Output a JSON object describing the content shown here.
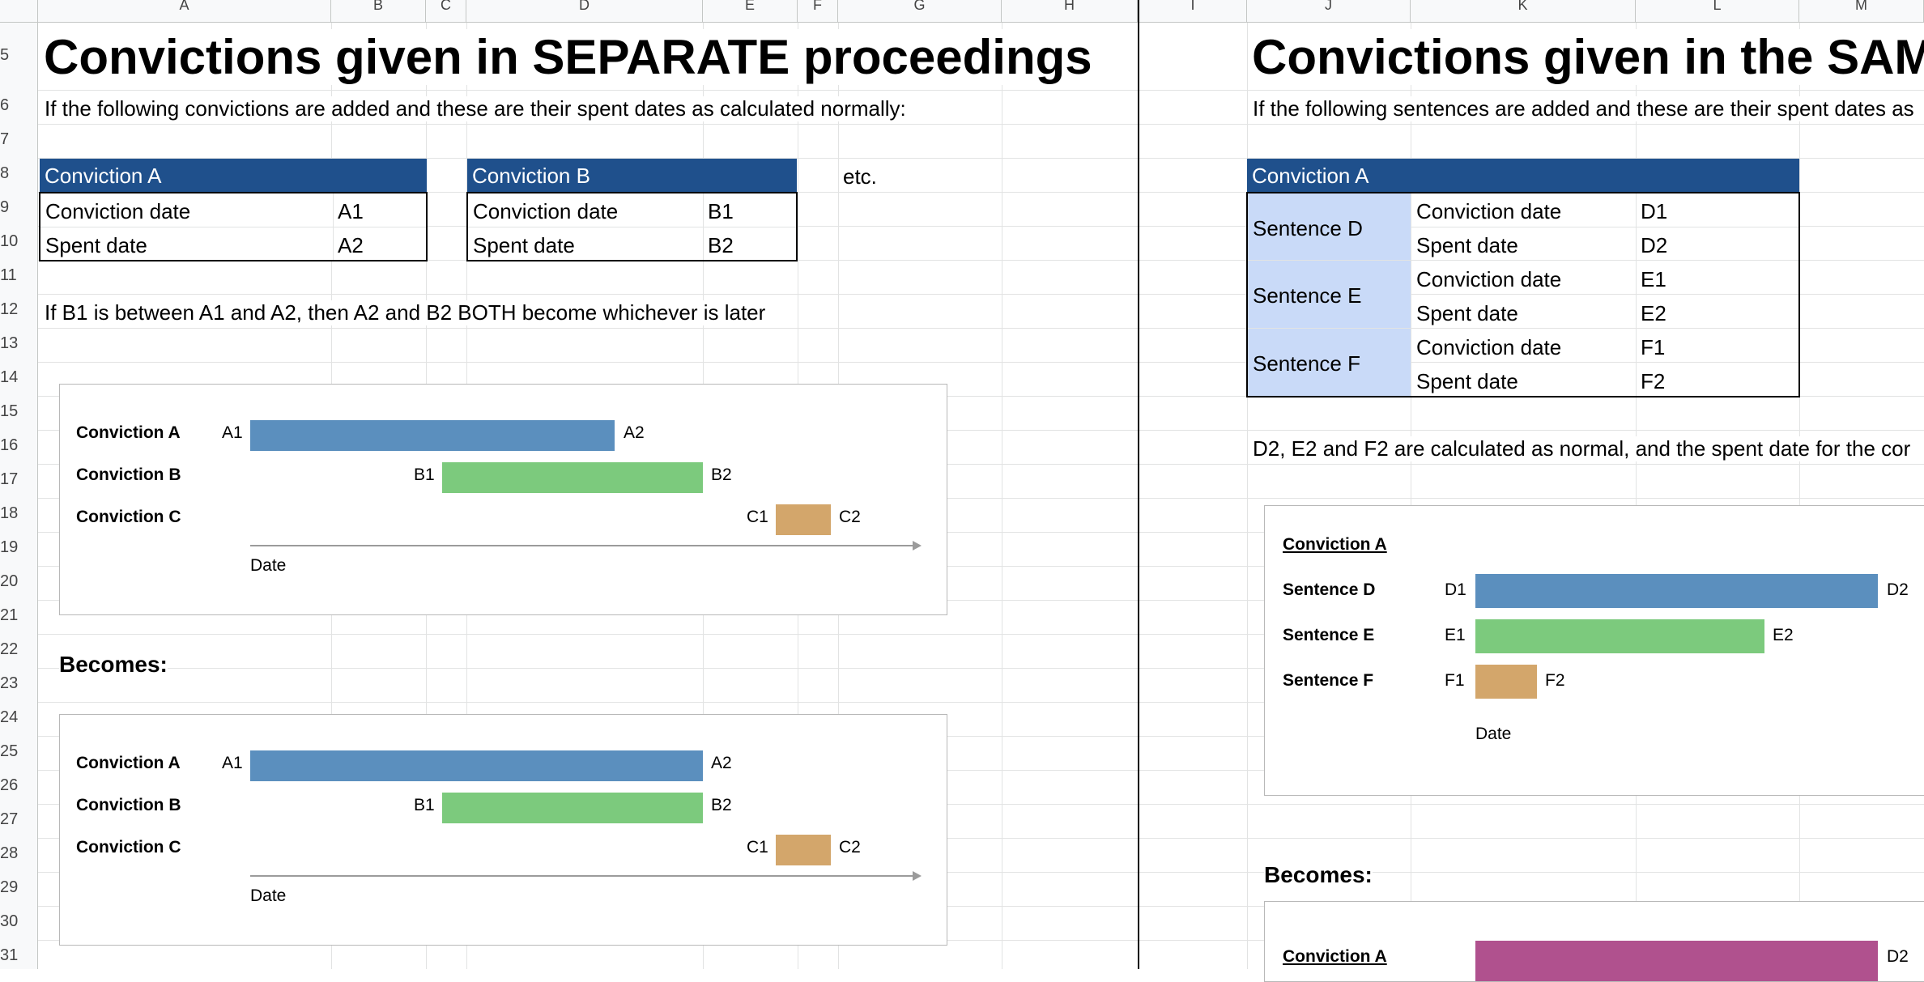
{
  "sheet": {
    "columns": [
      "A",
      "B",
      "C",
      "D",
      "E",
      "F",
      "G",
      "H",
      "I",
      "J",
      "K",
      "L",
      "M"
    ],
    "rows": [
      "5",
      "6",
      "7",
      "8",
      "9",
      "10",
      "11",
      "12",
      "13",
      "14",
      "15",
      "16",
      "17",
      "18",
      "19",
      "20",
      "21",
      "22",
      "23",
      "24",
      "25",
      "26",
      "27",
      "28",
      "29",
      "30",
      "31"
    ]
  },
  "left": {
    "title": "Convictions given in SEPARATE proceedings",
    "intro": "If the following convictions are added and these are their spent dates as calculated normally:",
    "table_a": {
      "header": "Conviction A",
      "rows": [
        [
          "Conviction date",
          "A1"
        ],
        [
          "Spent date",
          "A2"
        ]
      ]
    },
    "table_b": {
      "header": "Conviction B",
      "rows": [
        [
          "Conviction date",
          "B1"
        ],
        [
          "Spent date",
          "B2"
        ]
      ]
    },
    "etc": "etc.",
    "rule": "If B1 is between A1 and A2, then A2 and B2 BOTH become whichever is later",
    "becomes": "Becomes:",
    "chart_before": {
      "axis_label": "Date",
      "rows": [
        {
          "label": "Conviction A",
          "start": "A1",
          "end": "A2",
          "color": "#5b8fbe"
        },
        {
          "label": "Conviction B",
          "start": "B1",
          "end": "B2",
          "color": "#7cca7d"
        },
        {
          "label": "Conviction C",
          "start": "C1",
          "end": "C2",
          "color": "#d3a66b"
        }
      ]
    },
    "chart_after": {
      "axis_label": "Date",
      "rows": [
        {
          "label": "Conviction A",
          "start": "A1",
          "end": "A2",
          "color": "#5b8fbe"
        },
        {
          "label": "Conviction B",
          "start": "B1",
          "end": "B2",
          "color": "#7cca7d"
        },
        {
          "label": "Conviction C",
          "start": "C1",
          "end": "C2",
          "color": "#d3a66b"
        }
      ]
    }
  },
  "right": {
    "title": "Convictions given in the SAM",
    "intro": "If the following sentences are added and these are their spent dates as",
    "table": {
      "header": "Conviction A",
      "groups": [
        {
          "name": "Sentence D",
          "rows": [
            [
              "Conviction date",
              "D1"
            ],
            [
              "Spent date",
              "D2"
            ]
          ]
        },
        {
          "name": "Sentence E",
          "rows": [
            [
              "Conviction date",
              "E1"
            ],
            [
              "Spent date",
              "E2"
            ]
          ]
        },
        {
          "name": "Sentence F",
          "rows": [
            [
              "Conviction date",
              "F1"
            ],
            [
              "Spent date",
              "F2"
            ]
          ]
        }
      ]
    },
    "note": "D2, E2 and F2 are calculated as normal, and the spent date for the cor",
    "becomes": "Becomes:",
    "chart_before": {
      "heading": "Conviction A",
      "axis_label": "Date",
      "rows": [
        {
          "label": "Sentence D",
          "start": "D1",
          "end": "D2",
          "color": "#5b8fbe"
        },
        {
          "label": "Sentence E",
          "start": "E1",
          "end": "E2",
          "color": "#7cca7d"
        },
        {
          "label": "Sentence F",
          "start": "F1",
          "end": "F2",
          "color": "#d3a66b"
        }
      ]
    },
    "chart_after": {
      "heading": "Conviction A",
      "end": "D2",
      "color": "#b0518e"
    }
  }
}
